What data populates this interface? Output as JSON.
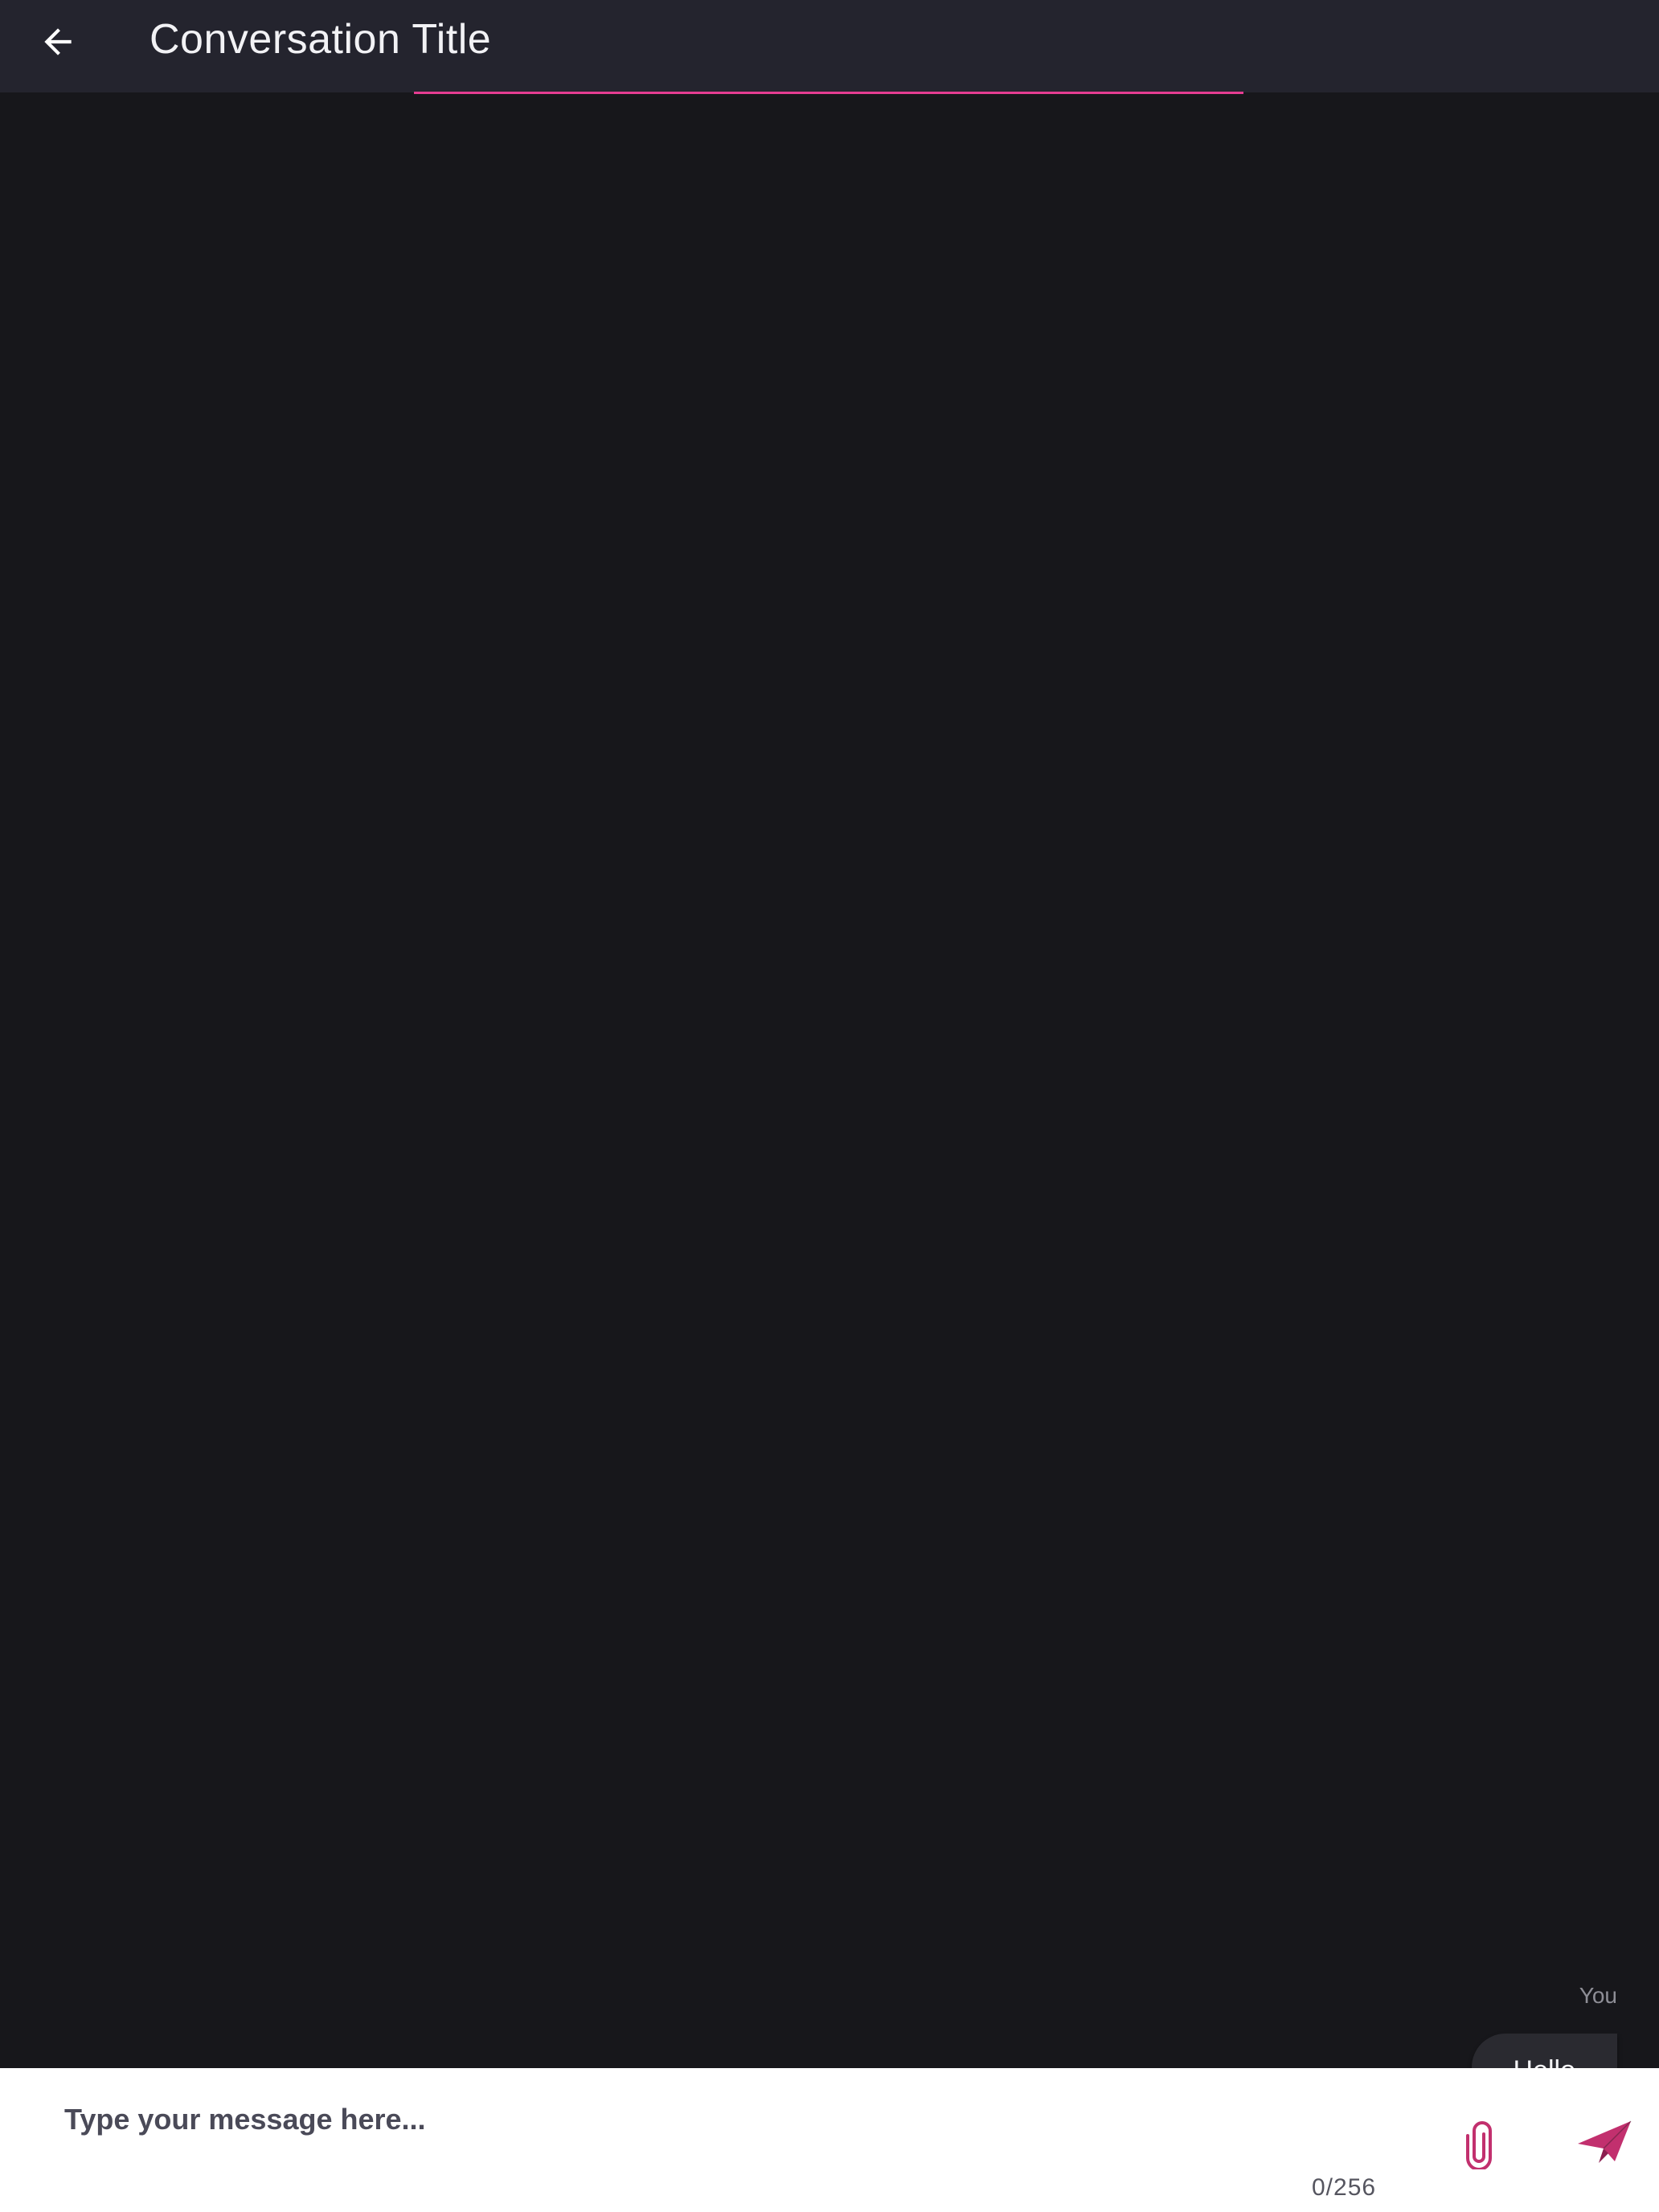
{
  "app_bar": {
    "title": "Conversation Title",
    "back_icon": "arrow-left-icon"
  },
  "messages": [
    {
      "sender": "You",
      "text": "Hello"
    }
  ],
  "composer": {
    "placeholder": "Type your message here...",
    "value": "",
    "counter": "0/256",
    "attach_icon": "paperclip-icon",
    "send_icon": "paper-plane-icon"
  },
  "colors": {
    "background": "#17171b",
    "app_bar": "#24242e",
    "accent": "#c2306e",
    "progress": "#e63d92",
    "bubble": "#2a2a30"
  }
}
